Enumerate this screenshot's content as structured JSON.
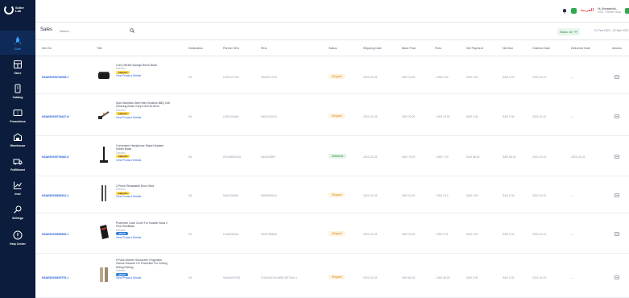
{
  "sidebar": {
    "logo_text": "Seller Lab",
    "items": [
      {
        "label": "Core",
        "icon": "rocket-icon",
        "active": true
      },
      {
        "label": "Store",
        "icon": "store-icon"
      },
      {
        "label": "Catalog",
        "icon": "catalog-icon"
      },
      {
        "label": "Promotions",
        "icon": "promotions-icon"
      },
      {
        "label": "Warehouse",
        "icon": "warehouse-icon"
      },
      {
        "label": "Fulfillment",
        "icon": "fulfillment-icon"
      },
      {
        "label": "Insd",
        "icon": "chart-icon"
      },
      {
        "label": "Settings",
        "icon": "settings-icon"
      },
      {
        "label": "Help Center",
        "icon": "help-icon"
      }
    ]
  },
  "header": {
    "language": "العربية",
    "user_name": "Hi, Ahmadmobi...",
    "user_sub": "KSA · Partner Shop"
  },
  "toolbar": {
    "title": "Sales",
    "search_placeholder": "Search...",
    "status_filter": "Status: All",
    "date_range": "01 Feb 2022 - 02 Mar 2022"
  },
  "columns": [
    "Item Nr.",
    "Title",
    "Destination",
    "Partner SKU",
    "SKU",
    "Status",
    "Shipping Date",
    "Base Price",
    "Fees",
    "Net Payment",
    "Net Due",
    "Ordered Date",
    "Delivered Date",
    "Actions"
  ],
  "view_details_label": "View Product Details",
  "rows": [
    {
      "item": "NSAE30095702095-1",
      "title": "Curry Wicket Sponge Brush Block",
      "brand": "Generic",
      "tag": "express",
      "tag_label": "express",
      "destination": "SA",
      "partner_sku": "LD00127164",
      "sku": "N23407137A",
      "status": "Shipped",
      "status_kind": "shipped",
      "shipping_date": "2022-03-03",
      "base_price": "SAR 15.00",
      "fees": "- SAR 3.94",
      "net_payment": "SAR 0.00",
      "net_due": "SAR 0.00",
      "ordered_date": "2022-03-01",
      "delivered_date": "—"
    },
    {
      "item": "NSAE30095704437-N",
      "title": "5pcs Stainless Steel Wire Brushes BBQ Grill Cleaning Brush Grey 5.5x0.5x19cm",
      "brand": "Generic",
      "tag": "express",
      "tag_label": "express",
      "destination": "SA",
      "partner_sku": "LD00124454",
      "sku": "N40313047A",
      "status": "Shipped",
      "status_kind": "shipped",
      "shipping_date": "2022-03-03",
      "base_price": "SAR 30.00",
      "fees": "- SAR 13.00",
      "net_payment": "SAR 0.00",
      "net_due": "SAR 0.00",
      "ordered_date": "2022-03-01",
      "delivered_date": "—"
    },
    {
      "item": "NSAE30095705460-S",
      "title": "Convenient Headphone Stand Headset Holder Black",
      "brand": "Generic",
      "tag": "express",
      "tag_label": "express",
      "destination": "SA",
      "partner_sku": "DFK4859242A",
      "sku": "N40424890",
      "status": "Delivered",
      "status_kind": "delivered",
      "shipping_date": "2022-03-03",
      "base_price": "SAR 75.00",
      "fees": "- SAR 7.00",
      "net_payment": "SAR 68.25",
      "net_due": "SAR 68.25",
      "ordered_date": "2022-03-01",
      "delivered_date": "2022-03-03"
    },
    {
      "item": "NSAE30095653202-1",
      "title": "2-Piece Retractable Drum Stick",
      "brand": "Generic",
      "tag": "express",
      "tag_label": "express",
      "destination": "SA",
      "partner_sku": "NISA750940",
      "sku": "N30090521A",
      "status": "Shipped",
      "status_kind": "shipped",
      "shipping_date": "2022-03-03",
      "base_price": "SAR 11.00",
      "fees": "- SAR 3.12",
      "net_payment": "SAR 0.00",
      "net_due": "SAR 0.00",
      "ordered_date": "2022-03-01",
      "delivered_date": "—"
    },
    {
      "item": "NSAE30095655508-1",
      "title": "Protective Case Cover For Huawei Nova 2 Plus Red/Black",
      "brand": "Generic",
      "tag": "global",
      "tag_label": "global",
      "destination": "SA",
      "partner_sku": "LD40098344",
      "sku": "N23278554A",
      "status": "Shipped",
      "status_kind": "shipped",
      "shipping_date": "2022-03-03",
      "base_price": "SAR 23.00",
      "fees": "- SAR 9.01",
      "net_payment": "SAR 0.00",
      "net_due": "SAR 0.00",
      "ordered_date": "2022-03-01",
      "delivered_date": "—"
    },
    {
      "item": "NSAE30095657575-1",
      "title": "8 Pairs Women Sunscreen Fingerless Gloves Summer UV Protection For Driving Riding Fishing",
      "brand": "Generic",
      "tag": "global",
      "tag_label": "global",
      "destination": "SA",
      "partner_sku": "NIAA5497903",
      "sku": "CGAGN11014569CDF70A0-1",
      "status": "Shipped",
      "status_kind": "shipped",
      "shipping_date": "2022-03-03",
      "base_price": "SAR 80.00",
      "fees": "- SAR 28.03",
      "net_payment": "SAR 0.00",
      "net_due": "SAR 0.00",
      "ordered_date": "2022-03-01",
      "delivered_date": "—"
    }
  ],
  "colors": {
    "sidebar": "#0c1c3c",
    "accent": "#2a62d6",
    "shipped": "#d68a1e",
    "delivered": "#2a8a48"
  }
}
